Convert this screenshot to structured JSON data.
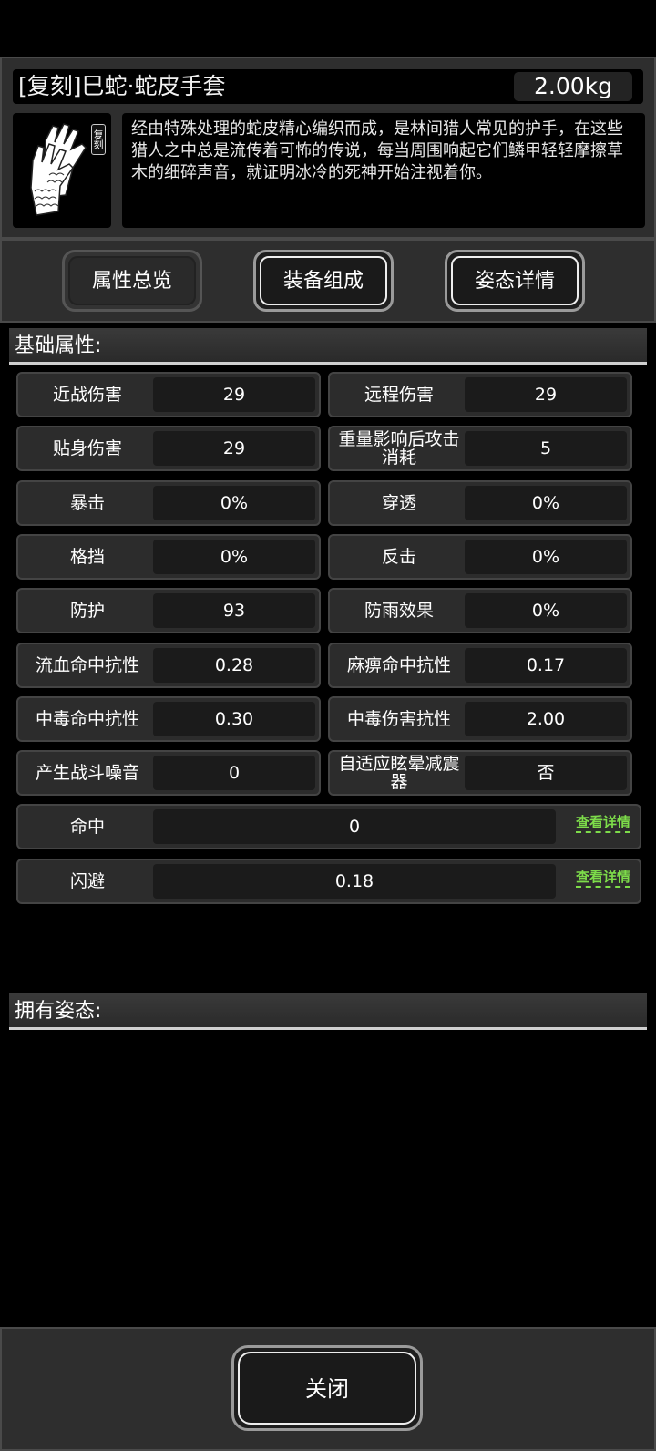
{
  "item": {
    "name": "[复刻]巳蛇·蛇皮手套",
    "weight": "2.00kg",
    "tag": "复刻",
    "icon": "snakeskin-gloves-icon",
    "description": "经由特殊处理的蛇皮精心编织而成，是林间猎人常见的护手，在这些猎人之中总是流传着可怖的传说，每当周围响起它们鳞甲轻轻摩擦草木的细碎声音，就证明冰冷的死神开始注视着你。"
  },
  "tabs": {
    "overview": "属性总览",
    "compose": "装备组成",
    "stance": "姿态详情"
  },
  "sections": {
    "basic": "基础属性:",
    "stance": "拥有姿态:"
  },
  "stats": [
    {
      "label": "近战伤害",
      "value": "29"
    },
    {
      "label": "远程伤害",
      "value": "29"
    },
    {
      "label": "贴身伤害",
      "value": "29"
    },
    {
      "label": "重量影响后攻击消耗",
      "value": "5"
    },
    {
      "label": "暴击",
      "value": "0%"
    },
    {
      "label": "穿透",
      "value": "0%"
    },
    {
      "label": "格挡",
      "value": "0%"
    },
    {
      "label": "反击",
      "value": "0%"
    },
    {
      "label": "防护",
      "value": "93"
    },
    {
      "label": "防雨效果",
      "value": "0%"
    },
    {
      "label": "流血命中抗性",
      "value": "0.28"
    },
    {
      "label": "麻痹命中抗性",
      "value": "0.17"
    },
    {
      "label": "中毒命中抗性",
      "value": "0.30"
    },
    {
      "label": "中毒伤害抗性",
      "value": "2.00"
    },
    {
      "label": "产生战斗噪音",
      "value": "0"
    },
    {
      "label": "自适应眩晕减震器",
      "value": "否"
    }
  ],
  "wide_stats": [
    {
      "label": "命中",
      "value": "0",
      "link": "查看详情"
    },
    {
      "label": "闪避",
      "value": "0.18",
      "link": "查看详情"
    }
  ],
  "close_label": "关闭",
  "colors": {
    "background": "#000000",
    "panel": "#2e2e2e",
    "link": "#7ddc4a"
  }
}
